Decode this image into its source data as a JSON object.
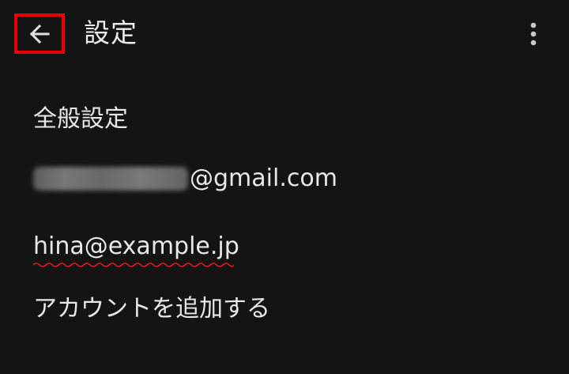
{
  "app_bar": {
    "title": "設定",
    "back_icon": "arrow-left-icon",
    "more_icon": "more-vert-icon",
    "highlight_color": "#ee0000"
  },
  "settings": {
    "general": "全般設定",
    "account_1_domain": "@gmail.com",
    "account_2": "hina@example.jp",
    "add_account": "アカウントを追加する"
  },
  "colors": {
    "background": "#141414",
    "text": "#e8e8e8",
    "spellcheck_underline": "#d81b1b"
  }
}
